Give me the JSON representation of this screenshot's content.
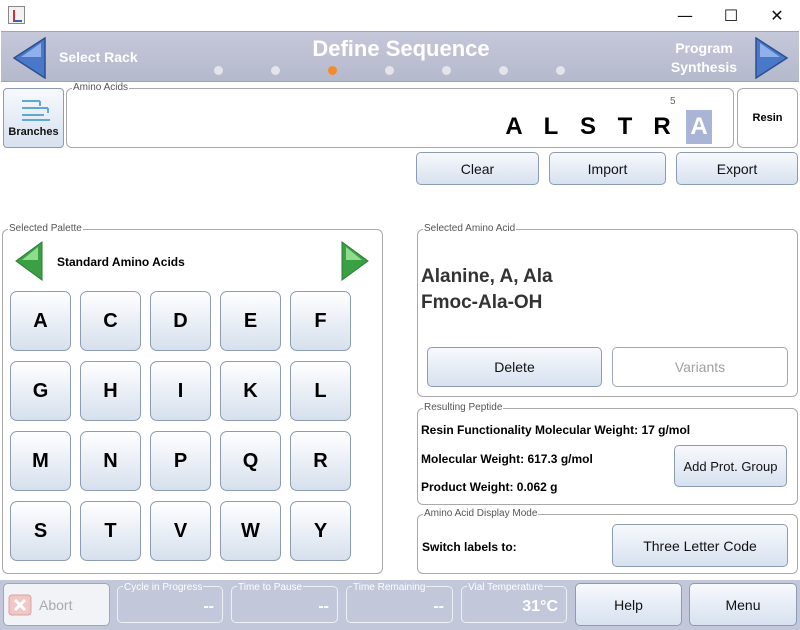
{
  "window": {
    "minimize_glyph": "—",
    "maximize_glyph": "☐",
    "close_glyph": "✕"
  },
  "header": {
    "prev_label": "Select Rack",
    "title": "Define Sequence",
    "next_label_line1": "Program",
    "next_label_line2": "Synthesis",
    "step_count": 7,
    "active_step": 3
  },
  "branches": {
    "label": "Branches"
  },
  "amino_acids": {
    "title": "Amino Acids",
    "sequence": [
      "A",
      "L",
      "S",
      "T",
      "R",
      "A"
    ],
    "position_marker": "5",
    "selected_index": 5
  },
  "resin": {
    "label": "Resin"
  },
  "actions": {
    "clear": "Clear",
    "import": "Import",
    "export": "Export"
  },
  "palette": {
    "title": "Selected Palette",
    "name": "Standard Amino Acids",
    "keys": [
      "A",
      "C",
      "D",
      "E",
      "F",
      "G",
      "H",
      "I",
      "K",
      "L",
      "M",
      "N",
      "P",
      "Q",
      "R",
      "S",
      "T",
      "V",
      "W",
      "Y"
    ]
  },
  "selected_amino_acid": {
    "title": "Selected Amino Acid",
    "name": "Alanine, A, Ala",
    "reagent": "Fmoc-Ala-OH",
    "delete_label": "Delete",
    "variants_label": "Variants"
  },
  "resulting_peptide": {
    "title": "Resulting Peptide",
    "resin_mw": "Resin Functionality Molecular Weight: 17 g/mol",
    "mw": "Molecular Weight: 617.3 g/mol",
    "product_weight": "Product Weight: 0.062 g",
    "add_prot_group_label": "Add Prot. Group"
  },
  "display_mode": {
    "title": "Amino Acid Display Mode",
    "switch_label": "Switch labels to:",
    "button_label": "Three Letter Code"
  },
  "statusbar": {
    "abort_label": "Abort",
    "cycle_label": "Cycle in Progress",
    "cycle_value": "--",
    "pause_label": "Time to Pause",
    "pause_value": "--",
    "remaining_label": "Time Remaining",
    "remaining_value": "--",
    "vial_label": "Vial Temperature",
    "vial_value": "31°C",
    "help_label": "Help",
    "menu_label": "Menu"
  },
  "colors": {
    "header_bg": "#c5c8da",
    "active_dot": "#f28a2e",
    "selected_letter_bg": "#a9b4d6",
    "palette_arrow": "#3aa043",
    "nav_arrow": "#4a78c8",
    "status_bg": "#c2c7da"
  }
}
